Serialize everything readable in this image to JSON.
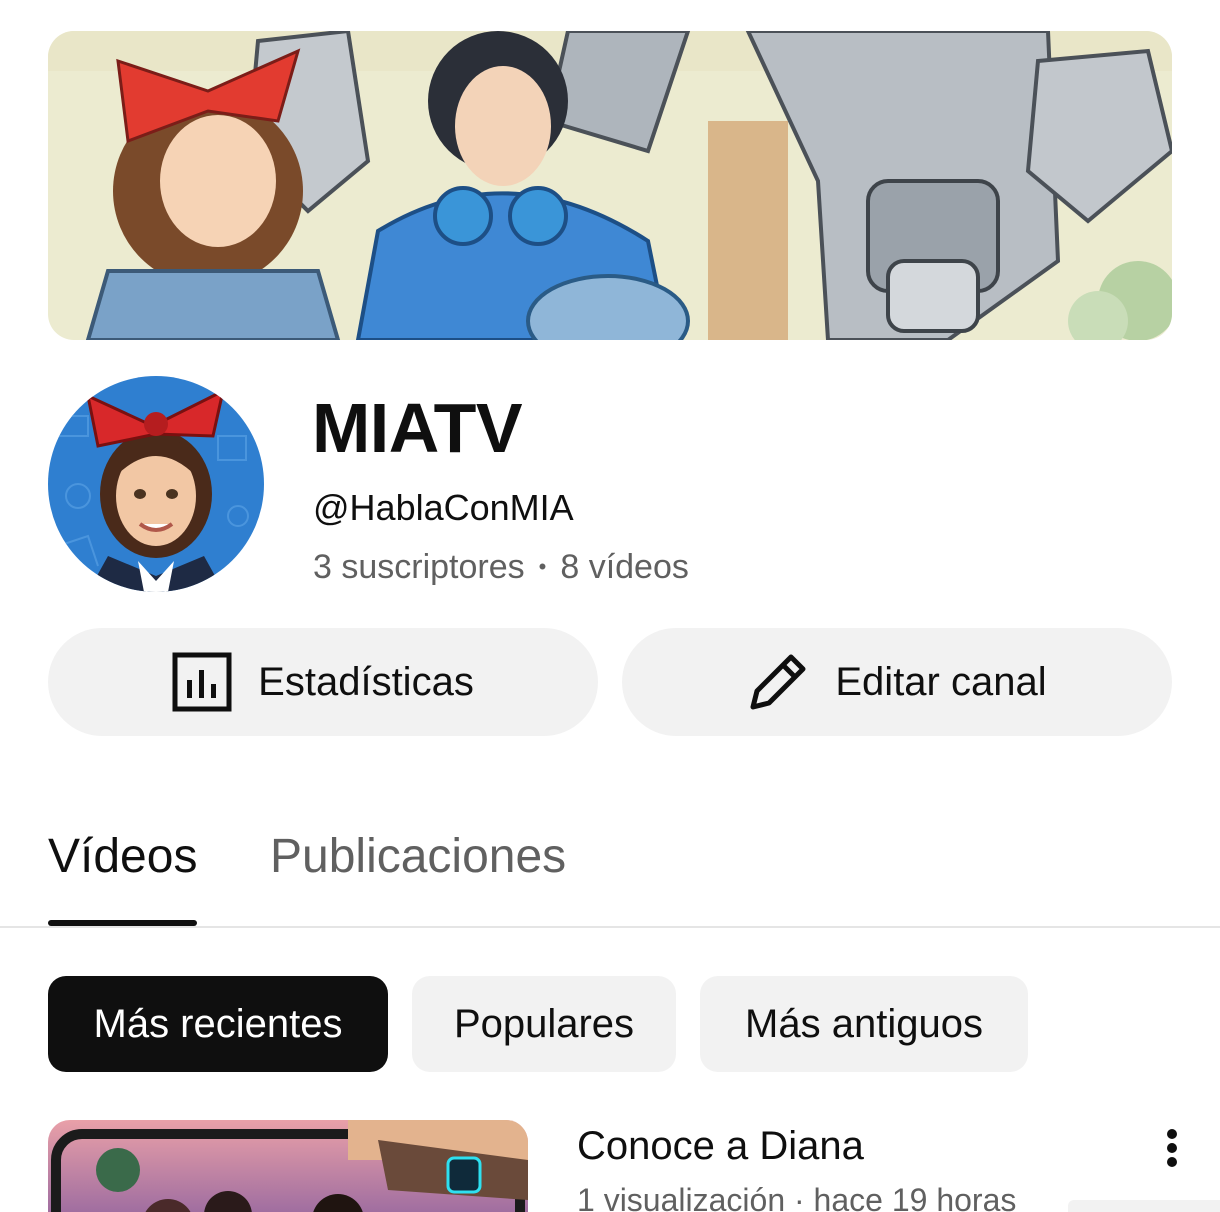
{
  "channel": {
    "name": "MIATV",
    "handle": "@HablaConMIA",
    "subscribers": "3 suscriptores",
    "separator": "•",
    "videos": "8 vídeos"
  },
  "actions": {
    "stats_label": "Estadísticas",
    "stats_icon": "bar-chart-icon",
    "edit_label": "Editar canal",
    "edit_icon": "pencil-icon"
  },
  "tabs": [
    {
      "label": "Vídeos",
      "selected": true
    },
    {
      "label": "Publicaciones",
      "selected": false
    }
  ],
  "filters": [
    {
      "label": "Más recientes",
      "selected": true
    },
    {
      "label": "Populares",
      "selected": false
    },
    {
      "label": "Más antiguos",
      "selected": false
    }
  ],
  "videos": [
    {
      "title": "Conoce a Diana",
      "meta": "1 visualización · hace 19 horas"
    }
  ],
  "colors": {
    "text_primary": "#0f0f0f",
    "text_secondary": "#606060",
    "chip_bg": "#f2f2f2",
    "chip_active_bg": "#0f0f0f"
  }
}
